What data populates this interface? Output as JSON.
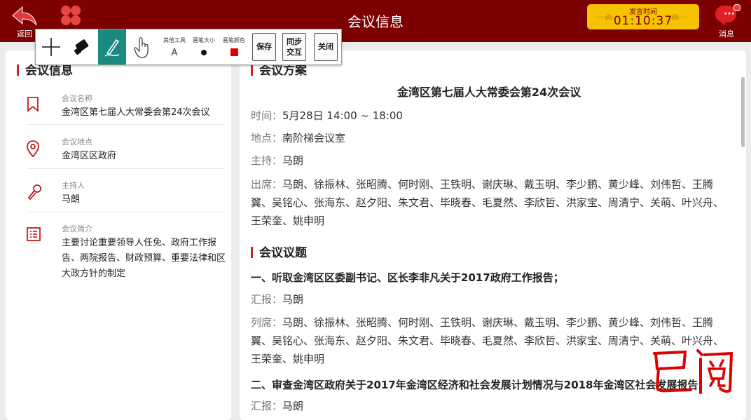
{
  "header": {
    "back_label": "返回",
    "title": "会议信息",
    "timer_label": "发言时间",
    "timer_value": "01:10:37",
    "messages_label": "消息"
  },
  "toolbar": {
    "other_tools_label": "其他工具",
    "other_tools_glyph": "A",
    "pen_size_label": "画笔大小",
    "pen_color_label": "画笔颜色",
    "pen_color": "#e00000",
    "save_label": "保存",
    "sync_label_1": "同步",
    "sync_label_2": "交互",
    "close_label": "关闭"
  },
  "left": {
    "section_title": "会议信息",
    "items": [
      {
        "label": "会议名称",
        "value": "金湾区第七届人大常委会第24次会议",
        "icon": "bookmark-icon"
      },
      {
        "label": "会议地点",
        "value": "金湾区区政府",
        "icon": "location-pin-icon"
      },
      {
        "label": "主持人",
        "value": "马朗",
        "icon": "microphone-icon"
      },
      {
        "label": "会议简介",
        "value": "主要讨论重要领导人任免、政府工作报告、两院报告、财政预算、重要法律和区大政方针的制定",
        "icon": "list-icon"
      }
    ]
  },
  "right": {
    "plan_title": "会议方案",
    "meeting_name": "金湾区第七届人大常委会第24次会议",
    "time_key": "时间：",
    "time_value": "5月28日 14:00 ~ 18:00",
    "place_key": "地点：",
    "place_value": "南阶梯会议室",
    "host_key": "主持：",
    "host_value": "马朗",
    "attend_key": "出席：",
    "attendees": "马朗、徐振林、张昭腾、何时刚、王铁明、谢庆琳、戴玉明、李少鹏、黄少峰、刘伟哲、王腾翼、吴铭心、张海东、赵夕阳、朱文君、毕晓春、毛夏然、李欣哲、洪家宝、周清宁、关萌、叶兴舟、王荣奎、姚申明",
    "agenda_title": "会议议题",
    "agenda": [
      {
        "title": "一、听取金湾区区委副书记、区长李非凡关于2017政府工作报告；",
        "report_key": "汇报：",
        "report_value": "马朗",
        "attend_key": "列席：",
        "attendees": "马朗、徐振林、张昭腾、何时刚、王铁明、谢庆琳、戴玉明、李少鹏、黄少峰、刘伟哲、王腾翼、吴铭心、张海东、赵夕阳、朱文君、毕晓春、毛夏然、李欣哲、洪家宝、周清宁、关萌、叶兴舟、王荣奎、姚申明"
      },
      {
        "title": "二、审查金湾区政府关于2017年金湾区经济和社会发展计划情况与2018年金湾区社会发展报告；",
        "report_key": "汇报：",
        "report_value": "马朗"
      }
    ]
  },
  "annotation": {
    "handwriting": "已阅",
    "color": "#e00000"
  },
  "colors": {
    "header_bg": "#7d0000",
    "accent": "#d02020",
    "timer_bg": "#f5c300",
    "active_tool": "#1a8a80"
  }
}
